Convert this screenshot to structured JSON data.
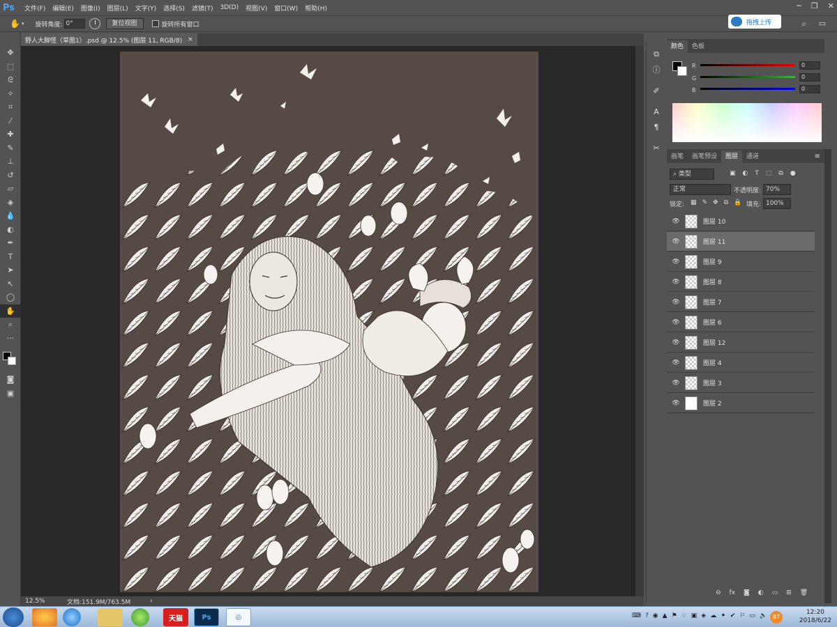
{
  "app": {
    "logo": "Ps"
  },
  "menu": [
    "文件(F)",
    "编辑(E)",
    "图像(I)",
    "图层(L)",
    "文字(Y)",
    "选择(S)",
    "滤镜(T)",
    "3D(D)",
    "视图(V)",
    "窗口(W)",
    "帮助(H)"
  ],
  "options": {
    "rotate_label": "旋转角度:",
    "rotate_value": "0°",
    "reset_view": "复位视图",
    "rotate_all": "旋转所有窗口"
  },
  "cloud_button": "拖拽上传",
  "document": {
    "tab_title": "野人大脚怪（草图1）.psd @ 12.5% (图层 11, RGB/8)",
    "close": "×",
    "zoom": "12.5%",
    "doc_size": "文档:151.9M/763.5M"
  },
  "color_panel": {
    "tabs": [
      "颜色",
      "色板"
    ],
    "active_tab": "颜色",
    "r_label": "R",
    "g_label": "G",
    "b_label": "B",
    "r": "0",
    "g": "0",
    "b": "0"
  },
  "layers_panel": {
    "tabs": [
      "画笔",
      "画笔预设",
      "图层",
      "通道"
    ],
    "active_tab": "图层",
    "filter_kind": "类型",
    "blend_mode": "正常",
    "opacity_label": "不透明度:",
    "opacity": "70%",
    "lock_label": "锁定:",
    "fill_label": "填充:",
    "fill": "100%",
    "layers": [
      {
        "name": "图层 10",
        "selected": false
      },
      {
        "name": "图层 11",
        "selected": true
      },
      {
        "name": "图层 9",
        "selected": false
      },
      {
        "name": "图层 8",
        "selected": false
      },
      {
        "name": "图层 7",
        "selected": false
      },
      {
        "name": "图层 6",
        "selected": false
      },
      {
        "name": "图层 12",
        "selected": false
      },
      {
        "name": "图层 4",
        "selected": false
      },
      {
        "name": "图层 3",
        "selected": false
      },
      {
        "name": "图层 2",
        "selected": false
      }
    ],
    "footer_fx": "fx"
  },
  "taskbar": {
    "tmall_label": "天猫",
    "ps_label": "Ps",
    "badge": "87",
    "time": "12:20",
    "date": "2018/6/22"
  },
  "colors": {
    "brand": "#4fa3e8",
    "artwork_bg": "#564a45",
    "selected_layer": "#6a6a6a"
  }
}
